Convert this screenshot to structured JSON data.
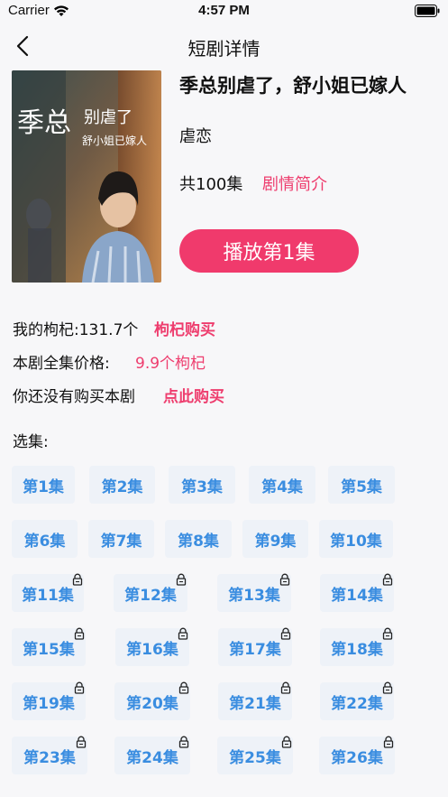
{
  "status_bar": {
    "carrier": "Carrier",
    "time": "4:57 PM"
  },
  "nav": {
    "title": "短剧详情"
  },
  "drama": {
    "title": "季总别虐了，舒小姐已嫁人",
    "genre": "虐恋",
    "episode_count": "共100集",
    "synopsis_link": "剧情简介",
    "play_button": "播放第1集",
    "poster_text_main": "季总别虐了",
    "poster_text_sub": "舒小姐已嫁人"
  },
  "account": {
    "balance_label": "我的枸杞:131.7个",
    "buy_goji_link": "枸杞购买",
    "price_label": "本剧全集价格:",
    "price_value": "9.9个枸杞",
    "not_purchased_label": "你还没有购买本剧",
    "buy_drama_link": "点此购买"
  },
  "select_label": "选集:",
  "accent_colors": {
    "pink": "#f03a6c",
    "blue": "#3a8de0",
    "chip_bg": "#eef2f8"
  },
  "episodes": [
    {
      "label": "第1集",
      "locked": false
    },
    {
      "label": "第2集",
      "locked": false
    },
    {
      "label": "第3集",
      "locked": false
    },
    {
      "label": "第4集",
      "locked": false
    },
    {
      "label": "第5集",
      "locked": false
    },
    {
      "label": "第6集",
      "locked": false
    },
    {
      "label": "第7集",
      "locked": false
    },
    {
      "label": "第8集",
      "locked": false
    },
    {
      "label": "第9集",
      "locked": false
    },
    {
      "label": "第10集",
      "locked": false
    },
    {
      "label": "第11集",
      "locked": true
    },
    {
      "label": "第12集",
      "locked": true
    },
    {
      "label": "第13集",
      "locked": true
    },
    {
      "label": "第14集",
      "locked": true
    },
    {
      "label": "第15集",
      "locked": true
    },
    {
      "label": "第16集",
      "locked": true
    },
    {
      "label": "第17集",
      "locked": true
    },
    {
      "label": "第18集",
      "locked": true
    },
    {
      "label": "第19集",
      "locked": true
    },
    {
      "label": "第20集",
      "locked": true
    },
    {
      "label": "第21集",
      "locked": true
    },
    {
      "label": "第22集",
      "locked": true
    },
    {
      "label": "第23集",
      "locked": true
    },
    {
      "label": "第24集",
      "locked": true
    },
    {
      "label": "第25集",
      "locked": true
    },
    {
      "label": "第26集",
      "locked": true
    }
  ]
}
